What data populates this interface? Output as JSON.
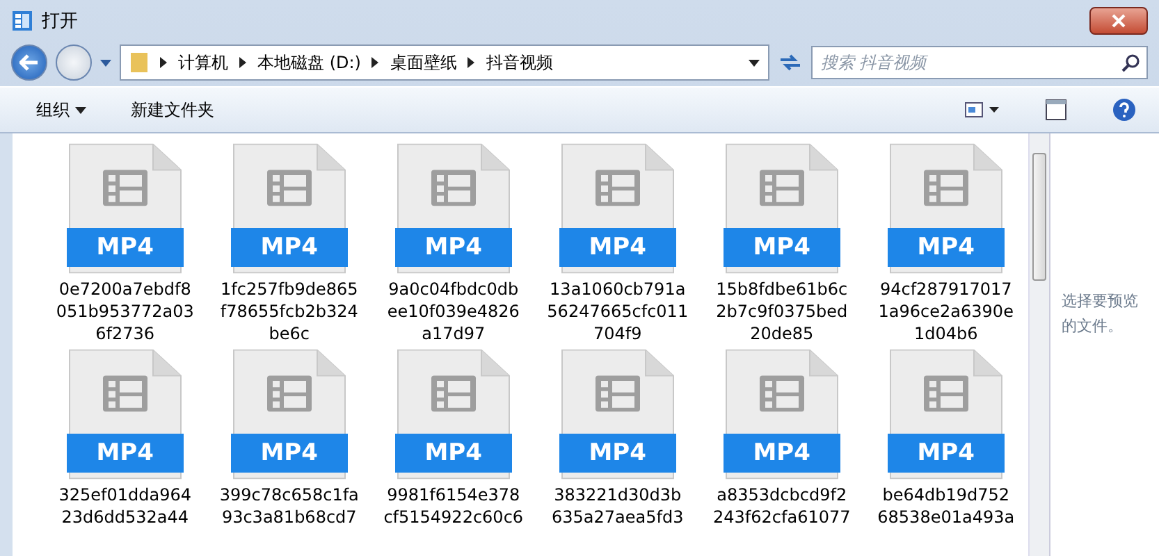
{
  "window": {
    "title": "打开"
  },
  "address_bar": {
    "crumbs": [
      "计算机",
      "本地磁盘 (D:)",
      "桌面壁纸",
      "抖音视频"
    ]
  },
  "search": {
    "placeholder": "搜索 抖音视频"
  },
  "toolbar": {
    "items": [
      "组织",
      "新建文件夹"
    ]
  },
  "files": [
    {
      "badge": "MP4",
      "lines": [
        "0e7200a7ebdf8",
        "051b953772a03",
        "6f2736"
      ]
    },
    {
      "badge": "MP4",
      "lines": [
        "1fc257fb9de865",
        "f78655fcb2b324",
        "be6c"
      ]
    },
    {
      "badge": "MP4",
      "lines": [
        "9a0c04fbdc0db",
        "ee10f039e4826",
        "a17d97"
      ]
    },
    {
      "badge": "MP4",
      "lines": [
        "13a1060cb791a",
        "56247665cfc011",
        "704f9"
      ]
    },
    {
      "badge": "MP4",
      "lines": [
        "15b8fdbe61b6c",
        "2b7c9f0375bed",
        "20de85"
      ]
    },
    {
      "badge": "MP4",
      "lines": [
        "94cf287917017",
        "1a96ce2a6390e",
        "1d04b6"
      ]
    },
    {
      "badge": "MP4",
      "lines": [
        "325ef01dda964",
        "23d6dd532a44"
      ]
    },
    {
      "badge": "MP4",
      "lines": [
        "399c78c658c1fa",
        "93c3a81b68cd7"
      ]
    },
    {
      "badge": "MP4",
      "lines": [
        "9981f6154e378",
        "cf5154922c60c6"
      ]
    },
    {
      "badge": "MP4",
      "lines": [
        "383221d30d3b",
        "635a27aea5fd3"
      ]
    },
    {
      "badge": "MP4",
      "lines": [
        "a8353dcbcd9f2",
        "243f62cfa61077"
      ]
    },
    {
      "badge": "MP4",
      "lines": [
        "be64db19d752",
        "68538e01a493a"
      ]
    }
  ],
  "preview": {
    "message": "选择要预览的文件。"
  }
}
